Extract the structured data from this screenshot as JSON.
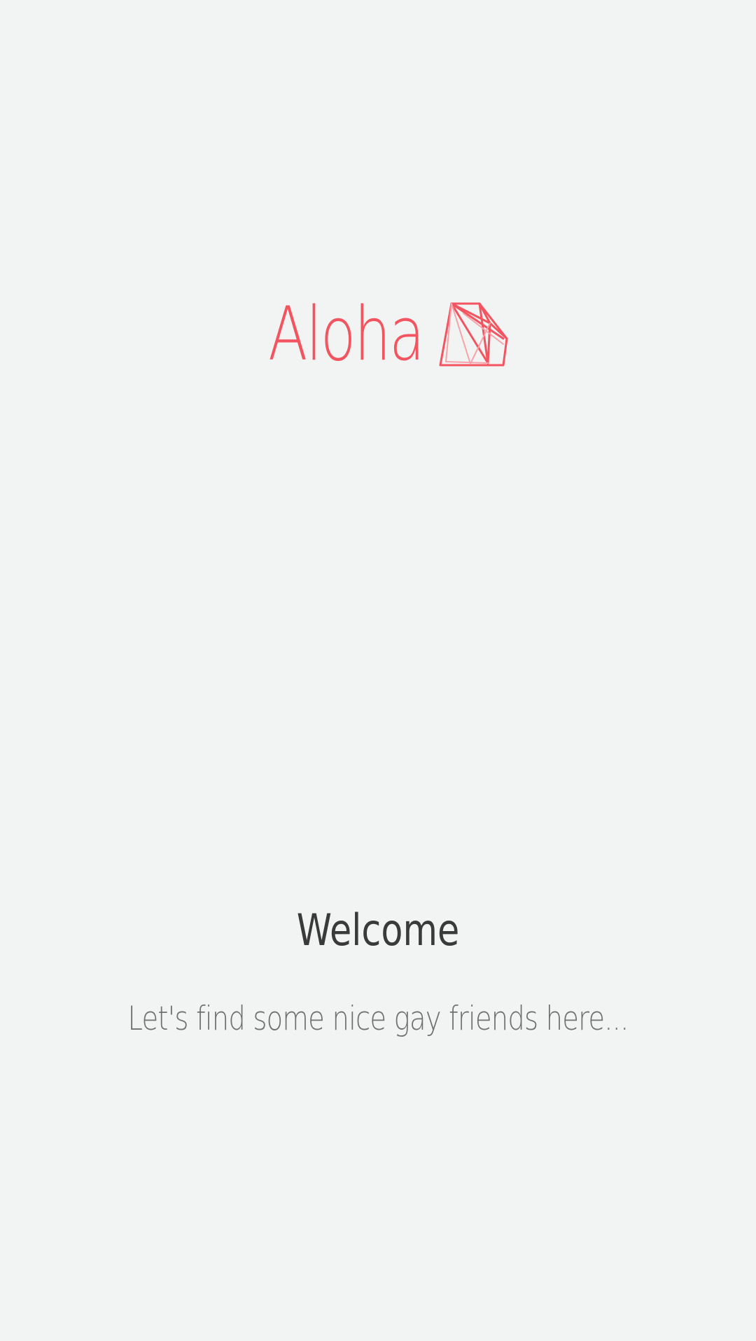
{
  "brand": {
    "name": "Aloha",
    "logo_icon": "gem-icon",
    "color": "#f25560"
  },
  "welcome": {
    "title": "Welcome",
    "subtitle": "Let's find some nice gay friends here..."
  },
  "colors": {
    "background": "#f2f3f3",
    "title_text": "#3a3a3a",
    "subtitle_text": "#707070"
  }
}
